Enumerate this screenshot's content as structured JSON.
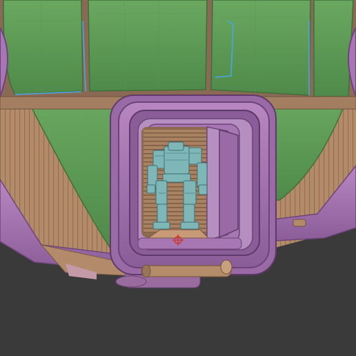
{
  "viewport": {
    "background": "#3a3a3a"
  },
  "model": {
    "colors": {
      "hull_green": "#5f9a58",
      "hull_green_light": "#7ab46c",
      "hull_tan": "#b58c6a",
      "hull_tan_dark": "#8d6a4f",
      "hull_purple": "#a876b4",
      "hull_purple_dark": "#7d4f8a",
      "mech_cyan": "#7fb6b8",
      "mech_cyan_dark": "#4f8688",
      "uv_seam_blue": "#4aa6e8",
      "marker_red": "#d0342c"
    },
    "icons": [
      "crosshair-marker-icon"
    ]
  }
}
